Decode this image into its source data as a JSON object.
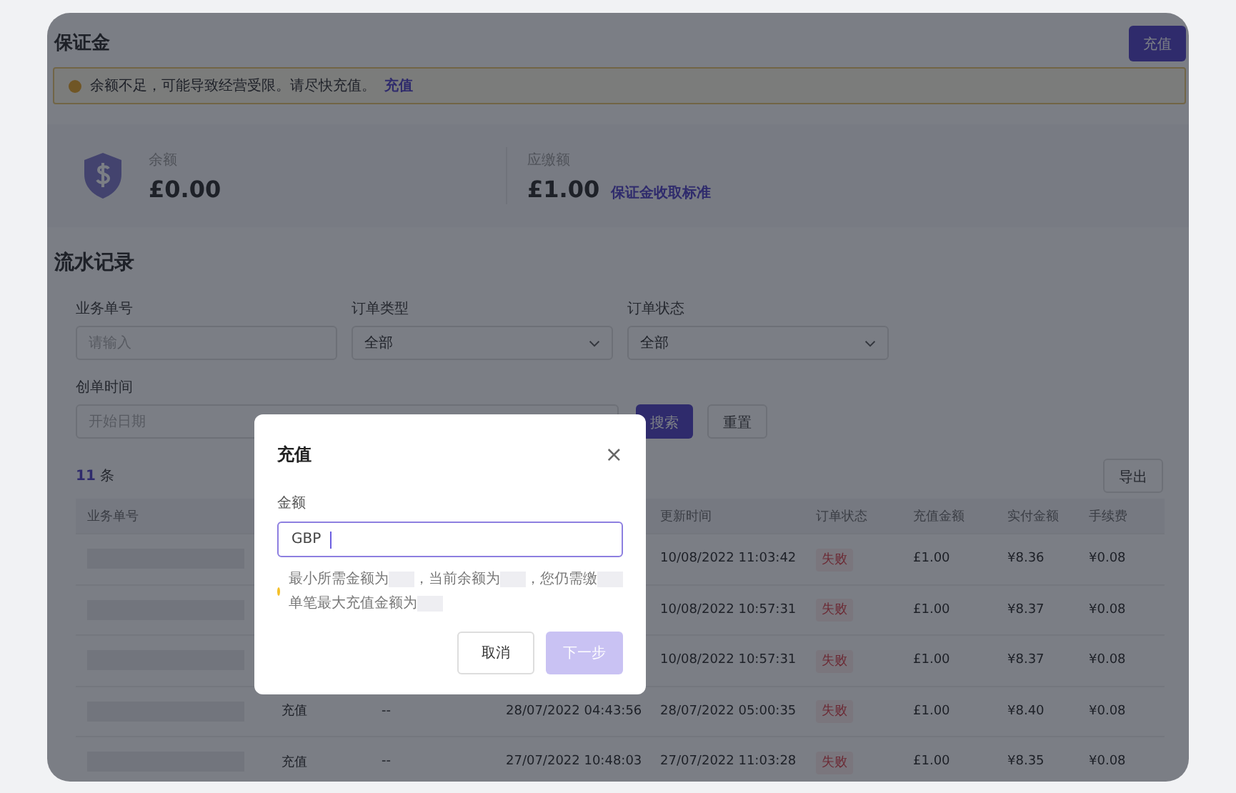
{
  "page": {
    "title": "保证金",
    "recharge_button": "充值"
  },
  "warning": {
    "text": "余额不足，可能导致经营受限。请尽快充值。",
    "link": "充值"
  },
  "balance": {
    "label": "余额",
    "value": "£0.00",
    "due_label": "应缴额",
    "due_value": "£1.00",
    "due_link": "保证金收取标准"
  },
  "records": {
    "title": "流水记录",
    "filters": [
      {
        "kind": "input",
        "label": "业务单号",
        "placeholder": "请输入"
      },
      {
        "kind": "select",
        "label": "订单类型",
        "value": "全部"
      },
      {
        "kind": "select",
        "label": "订单状态",
        "value": "全部"
      }
    ],
    "date_filter": {
      "label": "创单时间",
      "placeholder": "开始日期"
    },
    "search_button": "搜索",
    "reset_button": "重置",
    "count": "11",
    "count_unit": "条",
    "export_button": "导出",
    "table": {
      "columns": [
        {
          "label": "业务单号"
        },
        {
          "label": "更新时间"
        },
        {
          "label": "订单状态"
        },
        {
          "label": "充值金额"
        },
        {
          "label": "实付金额"
        },
        {
          "label": "手续费"
        }
      ],
      "rows": [
        {
          "updated": "10/08/2022 11:03:42",
          "status": "失败",
          "amount": "£1.00",
          "paid": "¥8.36",
          "fee": "¥0.08"
        },
        {
          "updated": "10/08/2022 10:57:31",
          "status": "失败",
          "amount": "£1.00",
          "paid": "¥8.37",
          "fee": "¥0.08"
        },
        {
          "updated": "10/08/2022 10:57:31",
          "status": "失败",
          "amount": "£1.00",
          "paid": "¥8.37",
          "fee": "¥0.08"
        },
        {
          "type": "充值",
          "related": "--",
          "created": "28/07/2022 04:43:56",
          "updated": "28/07/2022 05:00:35",
          "status": "失败",
          "amount": "£1.00",
          "paid": "¥8.40",
          "fee": "¥0.08"
        },
        {
          "type": "充值",
          "related": "--",
          "created": "27/07/2022 10:48:03",
          "updated": "27/07/2022 11:03:28",
          "status": "失败",
          "amount": "£1.00",
          "paid": "¥8.35",
          "fee": "¥0.08"
        }
      ]
    }
  },
  "dialog": {
    "title": "充值",
    "close": "×",
    "field_label": "金额",
    "currency": "GBP",
    "hint_lines": [
      [
        "最小所需金额为",
        "，当前余额为",
        "，您仍需缴"
      ],
      [
        "单笔最大充值金额为"
      ]
    ],
    "cancel_button": "取消",
    "next_button": "下一步",
    "next_disabled": true
  }
}
